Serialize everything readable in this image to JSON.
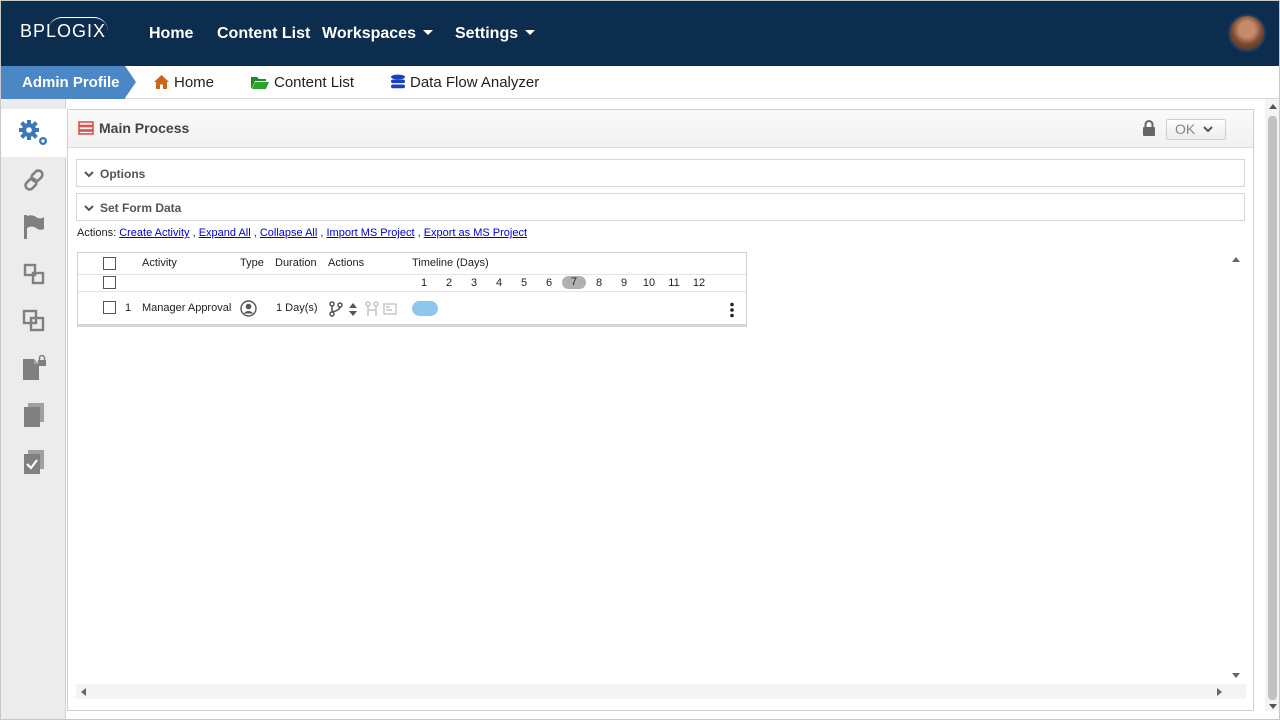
{
  "topnav": {
    "logo": "BPLOGIX",
    "links": [
      "Home",
      "Content List",
      "Workspaces",
      "Settings"
    ]
  },
  "breadcrumb": {
    "active": "Admin Profile",
    "items": [
      "Home",
      "Content List",
      "Data Flow Analyzer"
    ]
  },
  "sidebar": {
    "icons": [
      "gears-icon",
      "link-icon",
      "flag-icon",
      "steps-icon",
      "copy-squares-icon",
      "locked-document-icon",
      "documents-icon",
      "checked-document-icon"
    ]
  },
  "panel": {
    "title": "Main Process",
    "ok_label": "OK",
    "sections": [
      "Options",
      "Set Form Data"
    ],
    "actions_prefix": "Actions:",
    "actions": [
      "Create Activity",
      "Expand All",
      "Collapse All",
      "Import MS Project",
      "Export as MS Project"
    ]
  },
  "grid": {
    "headers": {
      "activity": "Activity",
      "type": "Type",
      "duration": "Duration",
      "actions": "Actions",
      "timeline": "Timeline (Days)"
    },
    "timeline_days": [
      "1",
      "2",
      "3",
      "4",
      "5",
      "6",
      "7",
      "8",
      "9",
      "10",
      "11",
      "12"
    ],
    "today": "7",
    "rows": [
      {
        "num": "1",
        "activity": "Manager Approval",
        "duration": "1 Day(s)"
      }
    ]
  },
  "colors": {
    "topnav_bg": "#0d2d4f",
    "active_crumb": "#4a87c4",
    "timeline_bar": "#8ec6ee",
    "link": "#0000cc"
  }
}
